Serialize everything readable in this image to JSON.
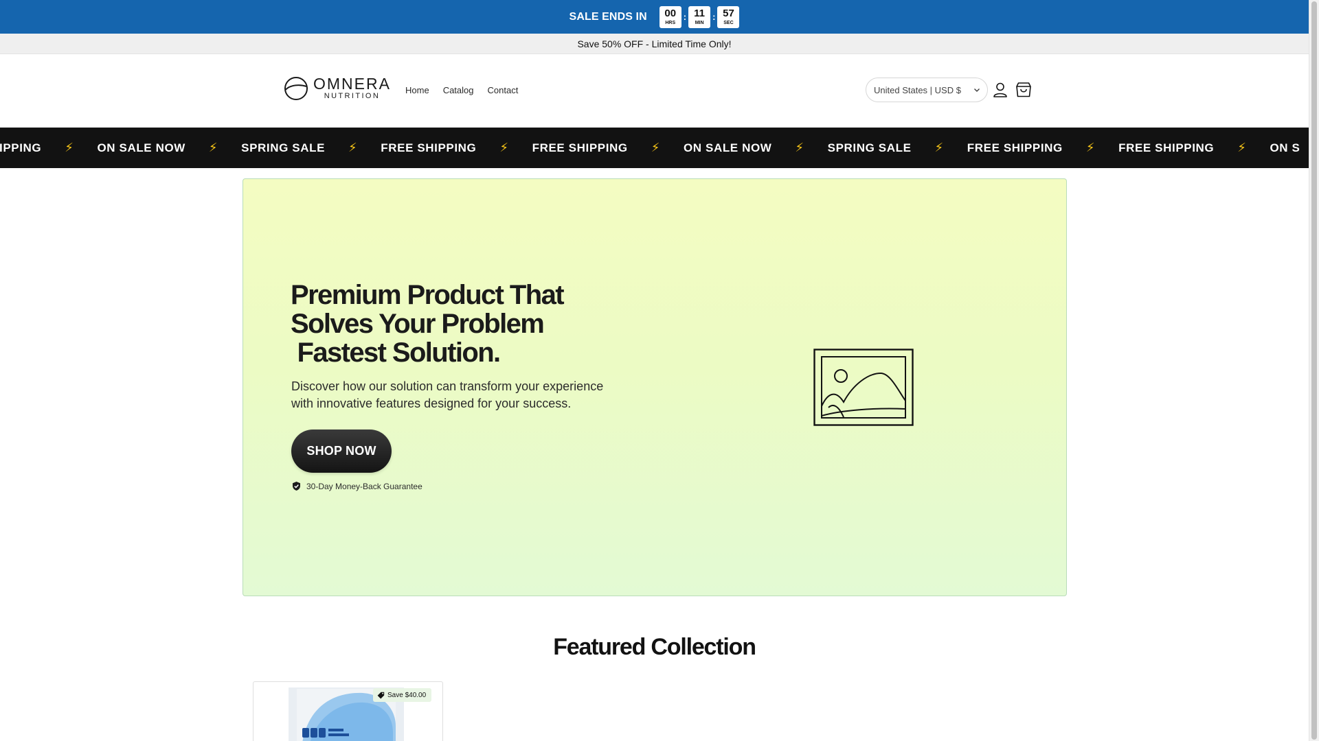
{
  "countdown": {
    "label": "SALE ENDS IN",
    "hours": "00",
    "hours_unit": "HRS",
    "minutes": "11",
    "minutes_unit": "MIN",
    "seconds": "57",
    "seconds_unit": "SEC",
    "separator": ":"
  },
  "announcement": {
    "text": "Save 50% OFF - Limited Time Only!"
  },
  "header": {
    "logo_word": "OMNERA",
    "logo_sub": "NUTRITION",
    "nav": [
      "Home",
      "Catalog",
      "Contact"
    ],
    "currency": "United States | USD $",
    "icons": {
      "account": "account-icon",
      "cart": "cart-icon",
      "chevron": "chevron-down-icon"
    }
  },
  "marquee": {
    "clipped_start": "IPPING",
    "items": [
      "ON SALE NOW",
      "SPRING SALE",
      "FREE SHIPPING",
      "FREE SHIPPING",
      "ON SALE NOW",
      "SPRING SALE",
      "FREE SHIPPING",
      "FREE SHIPPING"
    ],
    "clipped_end": "ON S",
    "bolt": "⚡"
  },
  "hero": {
    "title_lines": [
      "Premium Product That",
      "Solves Your Problem",
      " Fastest Solution."
    ],
    "description": "Discover how our solution can transform your experience with innovative features designed for your success.",
    "button": "SHOP NOW",
    "guarantee": "30-Day Money-Back Guarantee",
    "image_icon": "image-placeholder-icon"
  },
  "featured": {
    "title": "Featured Collection",
    "badge": "Save $40.00"
  },
  "colors": {
    "countdown_bg": "#1565ae",
    "marquee_bg": "#121212",
    "bolt": "#f7c518",
    "hero_gradient_top": "#f4fcc2",
    "hero_gradient_bottom": "#e3fad4",
    "button_bg": "#1e1e1e"
  }
}
